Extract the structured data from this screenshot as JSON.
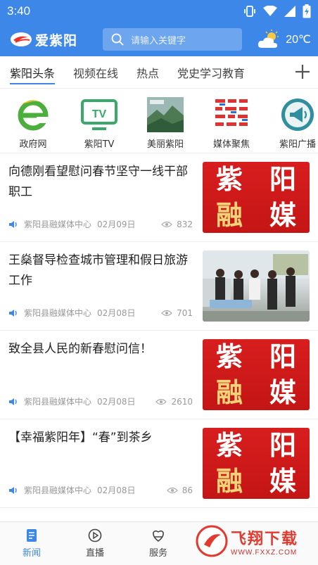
{
  "status": {
    "time": "3:40"
  },
  "header": {
    "app_name": "爱紫阳",
    "search_placeholder": "请输入关键字",
    "temperature": "20℃",
    "weather_icon": "partly-cloudy-icon"
  },
  "tabs": [
    {
      "label": "紫阳头条",
      "active": true
    },
    {
      "label": "视频在线"
    },
    {
      "label": "热点"
    },
    {
      "label": "党史学习教育"
    }
  ],
  "quick_links": [
    {
      "label": "政府网",
      "icon": "ie-browser-icon"
    },
    {
      "label": "紫阳TV",
      "icon": "tv-icon"
    },
    {
      "label": "美丽紫阳",
      "icon": "landscape-photo-icon"
    },
    {
      "label": "媒体聚焦",
      "icon": "media-logos-icon"
    },
    {
      "label": "紫阳广播",
      "icon": "broadcast-megaphone-icon"
    }
  ],
  "news": [
    {
      "title": "向德刚看望慰问春节坚守一线干部职工",
      "source": "紫阳县融媒体中心",
      "date": "02月09日",
      "views": "832",
      "thumb": "rongmei"
    },
    {
      "title": "王燊督导检查城市管理和假日旅游工作",
      "source": "紫阳县融媒体中心",
      "date": "02月08日",
      "views": "701",
      "thumb": "photo"
    },
    {
      "title": "致全县人民的新春慰问信！",
      "source": "紫阳县融媒体中心",
      "date": "02月08日",
      "views": "2610",
      "thumb": "rongmei"
    },
    {
      "title": "【幸福紫阳年】“春”到茶乡",
      "source": "紫阳县融媒体中心",
      "date": "02月08日",
      "views": "86",
      "thumb": "rongmei"
    }
  ],
  "thumb_text": {
    "line1a": "紫",
    "line1b": "阳",
    "line2a": "融",
    "line2b": "媒"
  },
  "bottom_nav": [
    {
      "label": "新闻",
      "active": true,
      "icon": "news-icon"
    },
    {
      "label": "直播",
      "icon": "play-circle-icon"
    },
    {
      "label": "服务",
      "icon": "service-icon"
    }
  ],
  "watermark": {
    "text": "飞翔下载",
    "sub": "WWW.FXXZ.COM"
  },
  "colors": {
    "brand_blue": "#3d87e8",
    "rongmei_red": "#c41515",
    "rongmei_gold": "#f3d37a"
  }
}
